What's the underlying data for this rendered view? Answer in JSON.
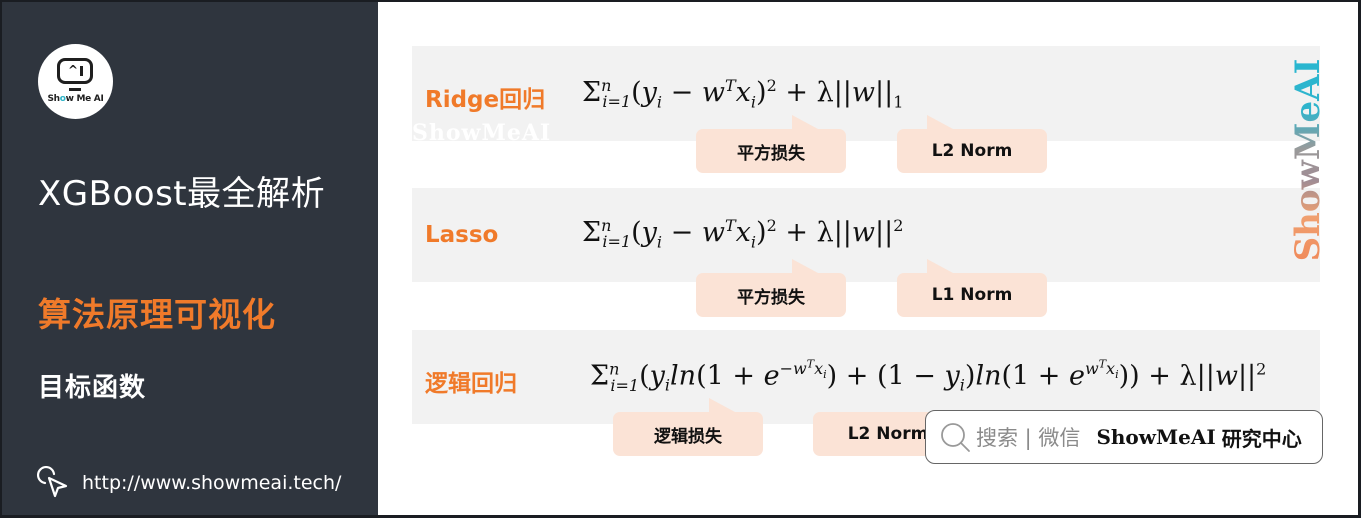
{
  "sidebar": {
    "logo": {
      "icon": "show-me-ai-logo",
      "text_pre": "Sh",
      "text_o": "o",
      "text_post": "w Me AI"
    },
    "title": "XGBoost最全解析",
    "subtitle": "算法原理可视化",
    "section": "目标函数",
    "link": {
      "icon": "cursor-click-icon",
      "url": "http://www.showmeai.tech/"
    }
  },
  "content": {
    "watermark_left": "ShowMeAI",
    "watermark_right": "ShowMeAI",
    "rows": [
      {
        "label": "Ridge回归",
        "formula_latex": "\\Sigma_{i=1}^{n}(y_i - w^T x_i)^2 + \\lambda||w||_1",
        "callouts": [
          "平方损失",
          "L2 Norm"
        ]
      },
      {
        "label": "Lasso",
        "formula_latex": "\\Sigma_{i=1}^{n}(y_i - w^T x_i)^2 + \\lambda||w||^2",
        "callouts": [
          "平方损失",
          "L1 Norm"
        ]
      },
      {
        "label": "逻辑回归",
        "formula_latex": "\\Sigma_{i=1}^{n}(y_i ln(1 + e^{-w^T x_i}) + (1 - y_i) ln(1 + e^{w^T x_i})) + \\lambda||w||^2",
        "callouts": [
          "逻辑损失",
          "L2 Norm"
        ]
      }
    ],
    "formula_tokens": {
      "sigma": "Σ",
      "n": "n",
      "i_eq_1": "i=1",
      "lambda": "λ",
      "w": "w",
      "T": "T",
      "y": "y",
      "x": "x",
      "i": "i",
      "one": "1",
      "two": "2",
      "e": "e",
      "ln": "ln",
      "minus": "−",
      "plus": "+"
    }
  },
  "search_badge": {
    "icon": "search-icon",
    "hint": "搜索 | 微信",
    "brand": "ShowMeAI",
    "brand_cn": "研究中心"
  },
  "colors": {
    "sidebar_bg": "#2f353e",
    "accent_orange": "#f07a2a",
    "band_bg": "#f2f2f2",
    "callout_bg": "#fbe3d6"
  }
}
